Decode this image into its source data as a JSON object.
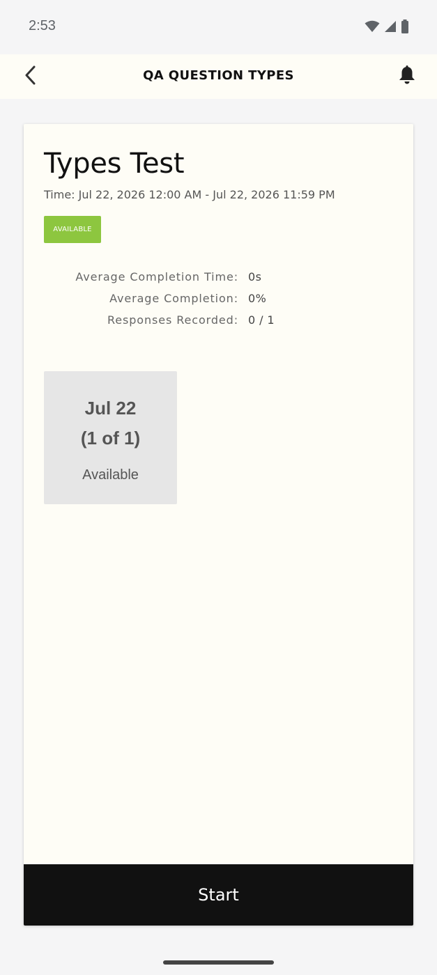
{
  "status_bar": {
    "time": "2:53",
    "icons": [
      "wifi-icon",
      "signal-icon",
      "battery-icon"
    ]
  },
  "app_bar": {
    "title": "QA QUESTION TYPES",
    "back_icon": "chevron-left-icon",
    "notification_icon": "bell-icon"
  },
  "card": {
    "title": "Types Test",
    "time": "Time: Jul 22, 2026 12:00 AM - Jul 22, 2026 11:59 PM",
    "badge": "AVAILABLE",
    "stats": [
      {
        "label": "Average Completion Time:",
        "value": "0s"
      },
      {
        "label": "Average Completion:",
        "value": "0%"
      },
      {
        "label": "Responses Recorded:",
        "value": "0 / 1"
      }
    ],
    "session": {
      "date": "Jul 22",
      "count": "(1 of 1)",
      "status": "Available"
    },
    "start_label": "Start"
  },
  "colors": {
    "badge": "#8dc63f",
    "card_background": "#fefdf6",
    "start_button": "#111111",
    "tile_background": "#e6e6e6"
  }
}
